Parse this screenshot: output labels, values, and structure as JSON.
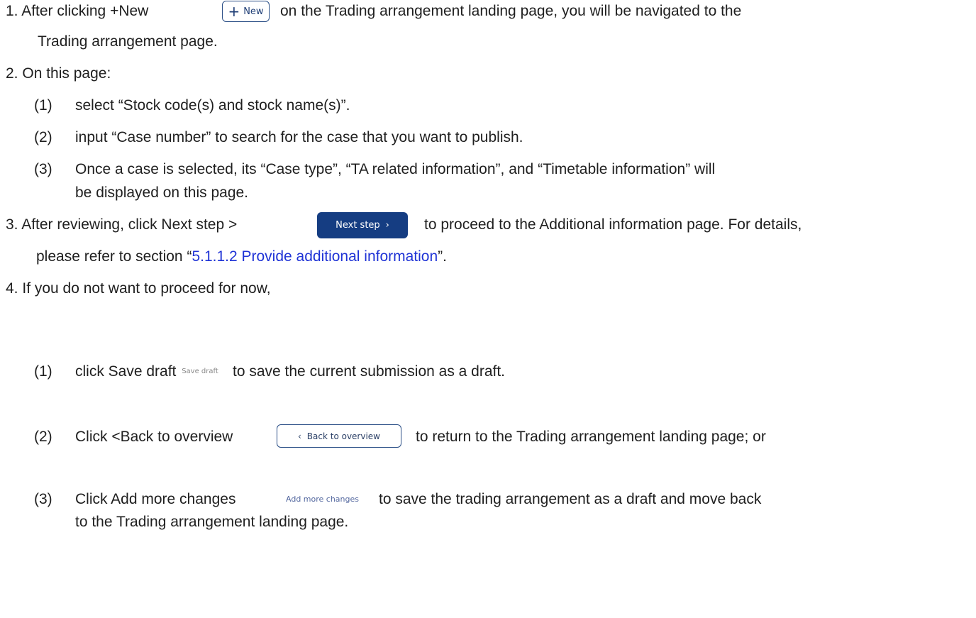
{
  "steps": {
    "s1": {
      "number": "1.",
      "before": "After clicking +New",
      "after": "on the Trading arrangement landing page, you will be navigated to the",
      "cont": "Trading arrangement page."
    },
    "s2": {
      "number": "2.",
      "text": "On this page:",
      "items": [
        {
          "num": "(1)",
          "text": "select “Stock code(s) and stock name(s)”."
        },
        {
          "num": "(2)",
          "text": "input “Case number” to search for the case that you want to publish."
        },
        {
          "num": "(3)",
          "text": "Once a case is selected, its “Case type”, “TA related information”, and “Timetable information” will",
          "cont": "be displayed on this page."
        }
      ]
    },
    "s3": {
      "number": "3.",
      "before": "After reviewing, click Next step >",
      "after": "to proceed to the Additional information page. For details,",
      "cont_before": "please refer to section “",
      "link": "5.1.1.2 Provide additional information",
      "cont_after": "”."
    },
    "s4": {
      "number": "4.",
      "text": "If you do not want to proceed for now,",
      "items": [
        {
          "num": "(1)",
          "before": "click Save draft",
          "after": "to save the current submission as a draft."
        },
        {
          "num": "(2)",
          "before": "Click <Back to overview",
          "after": "to return to the Trading arrangement landing page; or"
        },
        {
          "num": "(3)",
          "before": "Click Add more changes",
          "after": "to save the trading arrangement as a draft and move back",
          "cont": "to the Trading arrangement landing page."
        }
      ]
    }
  },
  "buttons": {
    "new_plus": "+",
    "new_label": "New",
    "next_label": "Next step",
    "next_chevron": "›",
    "save_label": "Save draft",
    "back_chevron": "‹",
    "back_label": "Back to overview",
    "addmore_label": "Add more changes"
  },
  "colors": {
    "link": "#1f33d6",
    "primary_button": "#153d82"
  }
}
